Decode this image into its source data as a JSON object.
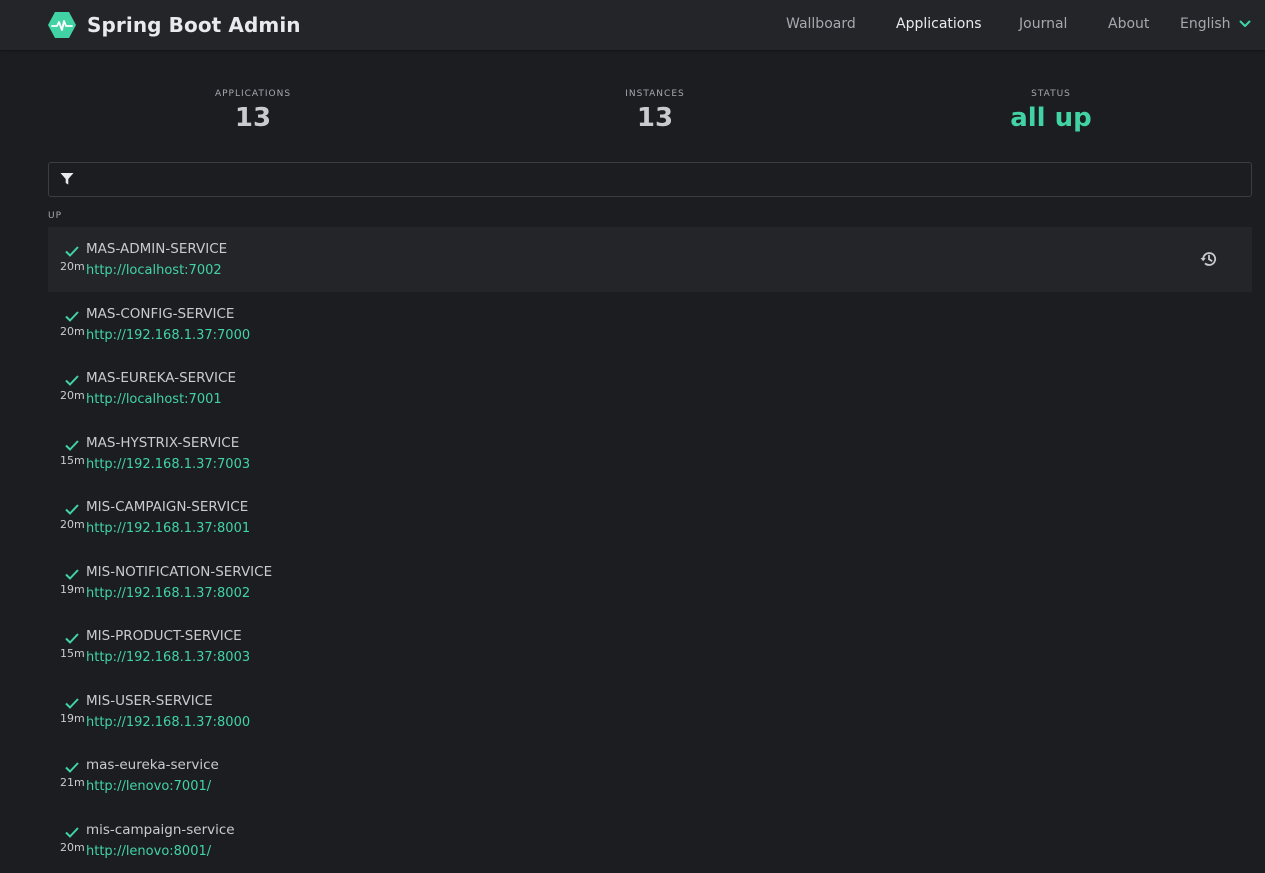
{
  "brand": {
    "name": "Spring Boot Admin"
  },
  "nav": {
    "items": [
      "Wallboard",
      "Applications",
      "Journal",
      "About"
    ],
    "active": "Applications",
    "language": "English"
  },
  "stats": {
    "applications": {
      "label": "APPLICATIONS",
      "value": "13"
    },
    "instances": {
      "label": "INSTANCES",
      "value": "13"
    },
    "status": {
      "label": "STATUS",
      "value": "all up"
    }
  },
  "filter": {
    "placeholder": ""
  },
  "group": {
    "label": "UP"
  },
  "applications": [
    {
      "name": "MAS-ADMIN-SERVICE",
      "url": "http://localhost:7002",
      "uptime": "20m"
    },
    {
      "name": "MAS-CONFIG-SERVICE",
      "url": "http://192.168.1.37:7000",
      "uptime": "20m"
    },
    {
      "name": "MAS-EUREKA-SERVICE",
      "url": "http://localhost:7001",
      "uptime": "20m"
    },
    {
      "name": "MAS-HYSTRIX-SERVICE",
      "url": "http://192.168.1.37:7003",
      "uptime": "15m"
    },
    {
      "name": "MIS-CAMPAIGN-SERVICE",
      "url": "http://192.168.1.37:8001",
      "uptime": "20m"
    },
    {
      "name": "MIS-NOTIFICATION-SERVICE",
      "url": "http://192.168.1.37:8002",
      "uptime": "19m"
    },
    {
      "name": "MIS-PRODUCT-SERVICE",
      "url": "http://192.168.1.37:8003",
      "uptime": "15m"
    },
    {
      "name": "MIS-USER-SERVICE",
      "url": "http://192.168.1.37:8000",
      "uptime": "19m"
    },
    {
      "name": "mas-eureka-service",
      "url": "http://lenovo:7001/",
      "uptime": "21m"
    },
    {
      "name": "mis-campaign-service",
      "url": "http://lenovo:8001/",
      "uptime": "20m"
    }
  ],
  "icons": {
    "logo": "heartbeat-icon",
    "language_toggle": "chevron-down-icon",
    "filter": "filter-icon",
    "status": "check-icon",
    "history": "history-icon"
  },
  "colors": {
    "accent": "#42d3a5",
    "background": "#1b1d20",
    "navbar": "#232528"
  }
}
